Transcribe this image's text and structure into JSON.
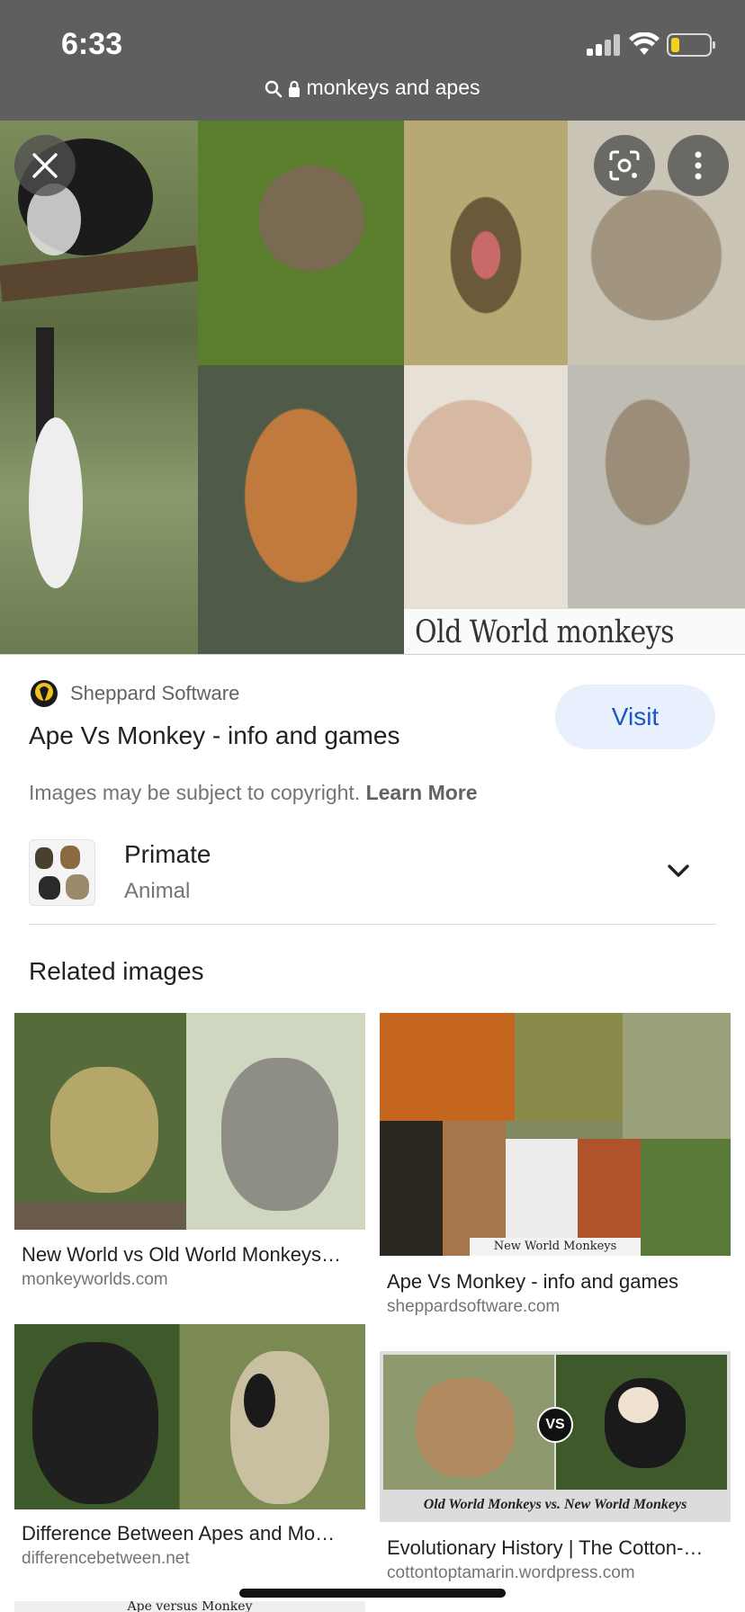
{
  "status": {
    "time": "6:33"
  },
  "url_bar": {
    "query": "monkeys and apes"
  },
  "hero": {
    "caption": "Old World monkeys"
  },
  "source": {
    "name": "Sheppard Software",
    "title": "Ape Vs Monkey - info and games",
    "visit_label": "Visit",
    "copyright_text": "Images may be subject to copyright.",
    "learn_more": "Learn More"
  },
  "entity": {
    "title": "Primate",
    "subtitle": "Animal"
  },
  "related": {
    "heading": "Related images",
    "items": [
      {
        "title": "New World vs Old World Monkeys…",
        "domain": "monkeyworlds.com"
      },
      {
        "title": "Ape Vs Monkey - info and games",
        "domain": "sheppardsoftware.com",
        "img_caption": "New World Monkeys"
      },
      {
        "title": "Difference Between Apes and Mo…",
        "domain": "differencebetween.net"
      },
      {
        "title": "Evolutionary History | The Cotton-…",
        "domain": "cottontoptamarin.wordpress.com",
        "img_caption": "Old World Monkeys vs. New World Monkeys",
        "vs_badge": "VS"
      }
    ],
    "partial_caption": "Ape versus Monkey"
  },
  "colors": {
    "top_bar": "#5f5f5f",
    "visit_bg": "#e8f0fe",
    "visit_text": "#1a57c6",
    "battery": "#f2d21b"
  }
}
